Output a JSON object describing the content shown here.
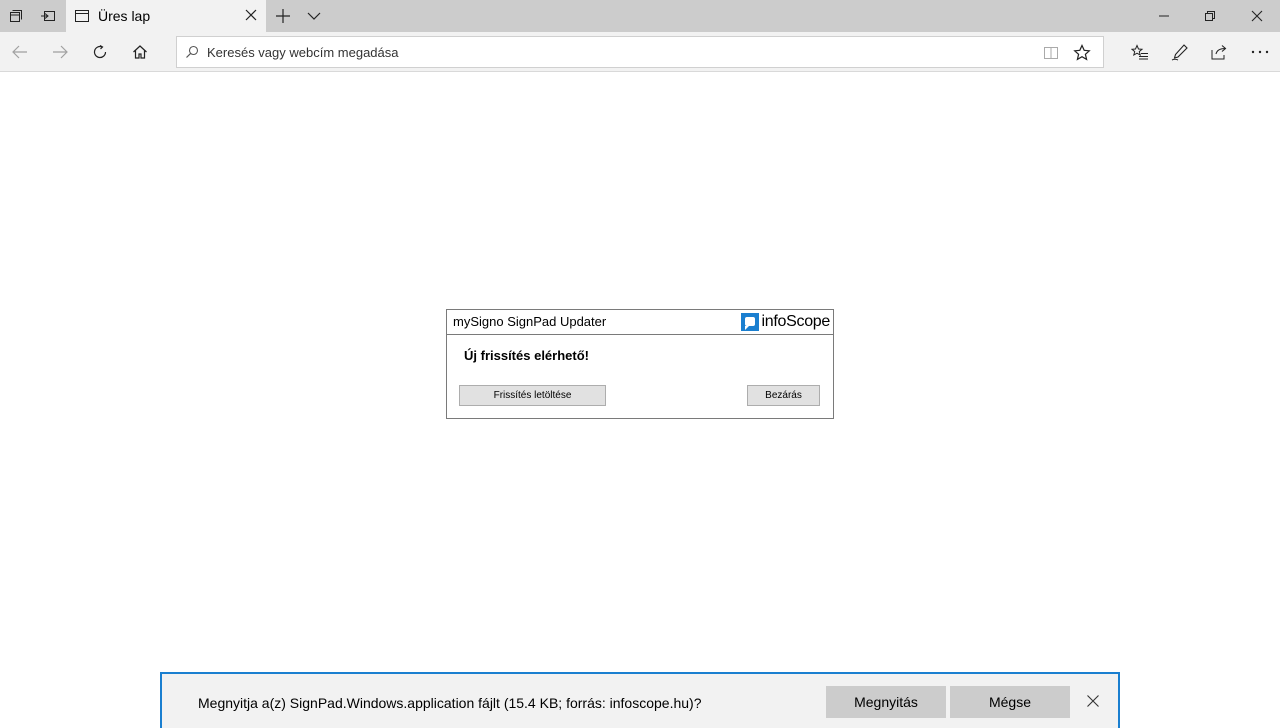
{
  "browser": {
    "tab_title": "Üres lap",
    "address_placeholder": "Keresés vagy webcím megadása"
  },
  "dialog": {
    "title": "mySigno SignPad Updater",
    "logo_text": "infoScope",
    "message": "Új frissítés elérhető!",
    "download_button": "Frissítés letöltése",
    "close_button": "Bezárás"
  },
  "download_bar": {
    "message": "Megnyitja a(z) SignPad.Windows.application fájlt (15.4 KB; forrás: infoscope.hu)?",
    "open_button": "Megnyitás",
    "cancel_button": "Mégse"
  },
  "icons": {
    "tab_manager": "tab-manager-icon",
    "set_aside": "set-aside-tabs-icon",
    "page": "page-icon",
    "close": "close-icon",
    "new_tab": "plus-icon",
    "tab_list": "chevron-down-icon",
    "minimize": "minimize-icon",
    "restore": "restore-icon",
    "back": "back-arrow-icon",
    "forward": "forward-arrow-icon",
    "refresh": "refresh-icon",
    "home": "home-icon",
    "search": "search-icon",
    "reading_view": "reading-view-icon",
    "favorite": "star-icon",
    "favorites_hub": "favorites-hub-icon",
    "notes": "pen-icon",
    "share": "share-icon",
    "more": "more-icon"
  },
  "colors": {
    "tabbar": "#cccccc",
    "navbar": "#f2f2f2",
    "download_accent": "#1a7fd0",
    "logo_blue": "#1a7fd0"
  }
}
